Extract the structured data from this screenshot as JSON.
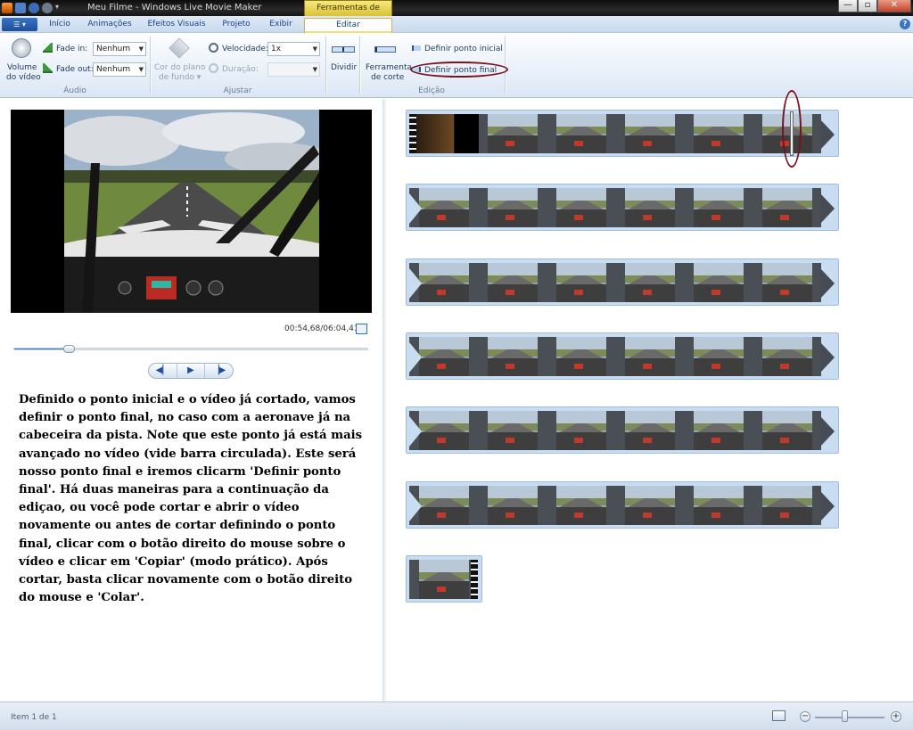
{
  "window": {
    "title": "Meu Filme - Windows Live Movie Maker",
    "context_tab": "Ferramentas de Vídeo",
    "controls": {
      "minimize": "—",
      "maximize": "▫",
      "close": "✕"
    }
  },
  "tabs": [
    {
      "label": "Início"
    },
    {
      "label": "Animações"
    },
    {
      "label": "Efeitos Visuais"
    },
    {
      "label": "Projeto"
    },
    {
      "label": "Exibir"
    },
    {
      "label": "Editar",
      "active": true
    }
  ],
  "help_label": "?",
  "ribbon": {
    "audio": {
      "group_label": "Áudio",
      "volume_label_1": "Volume",
      "volume_label_2": "do vídeo",
      "fade_in_label": "Fade in:",
      "fade_in_value": "Nenhum",
      "fade_out_label": "Fade out:",
      "fade_out_value": "Nenhum"
    },
    "ajustar": {
      "group_label": "Ajustar",
      "bg_color_label_1": "Cor do plano",
      "bg_color_label_2": "de fundo ▾",
      "speed_label": "Velocidade:",
      "speed_value": "1x",
      "duration_label": "Duração:",
      "duration_value": ""
    },
    "edicao": {
      "group_label": "Edição",
      "split_label": "Dividir",
      "trim_label_1": "Ferramenta",
      "trim_label_2": "de corte",
      "set_start_label": "Definir ponto inicial",
      "set_end_label": "Definir ponto final"
    }
  },
  "preview": {
    "timecode": "00:54,68/06:04,41",
    "seek_fraction": 0.15,
    "controls": {
      "prev": "◀▏",
      "play": "▶",
      "next": "▕▶"
    }
  },
  "caption": "Definido o ponto inicial e o vídeo já cortado, vamos definir o ponto final, no caso com a aeronave já na cabeceira da pista. Note que este ponto já está mais avançado no vídeo (vide barra circulada). Este será nosso ponto final e iremos clicarm 'Definir ponto final'. Há duas maneiras para a continuação da ediçao, ou você pode cortar e abrir o vídeo novamente ou antes de cortar definindo o ponto final, clicar com o botão direito do mouse sobre o vídeo e clicar em 'Copiar' (modo prático). Após cortar, basta clicar novamente com o botão direito do mouse e 'Colar'.",
  "storyboard": {
    "rows": 6,
    "frames_per_row": 6,
    "last_row_frames": 1
  },
  "status": {
    "item_text": "Item 1 de 1",
    "zoom_minus": "−",
    "zoom_plus": "+",
    "zoom_fraction": 0.4
  }
}
